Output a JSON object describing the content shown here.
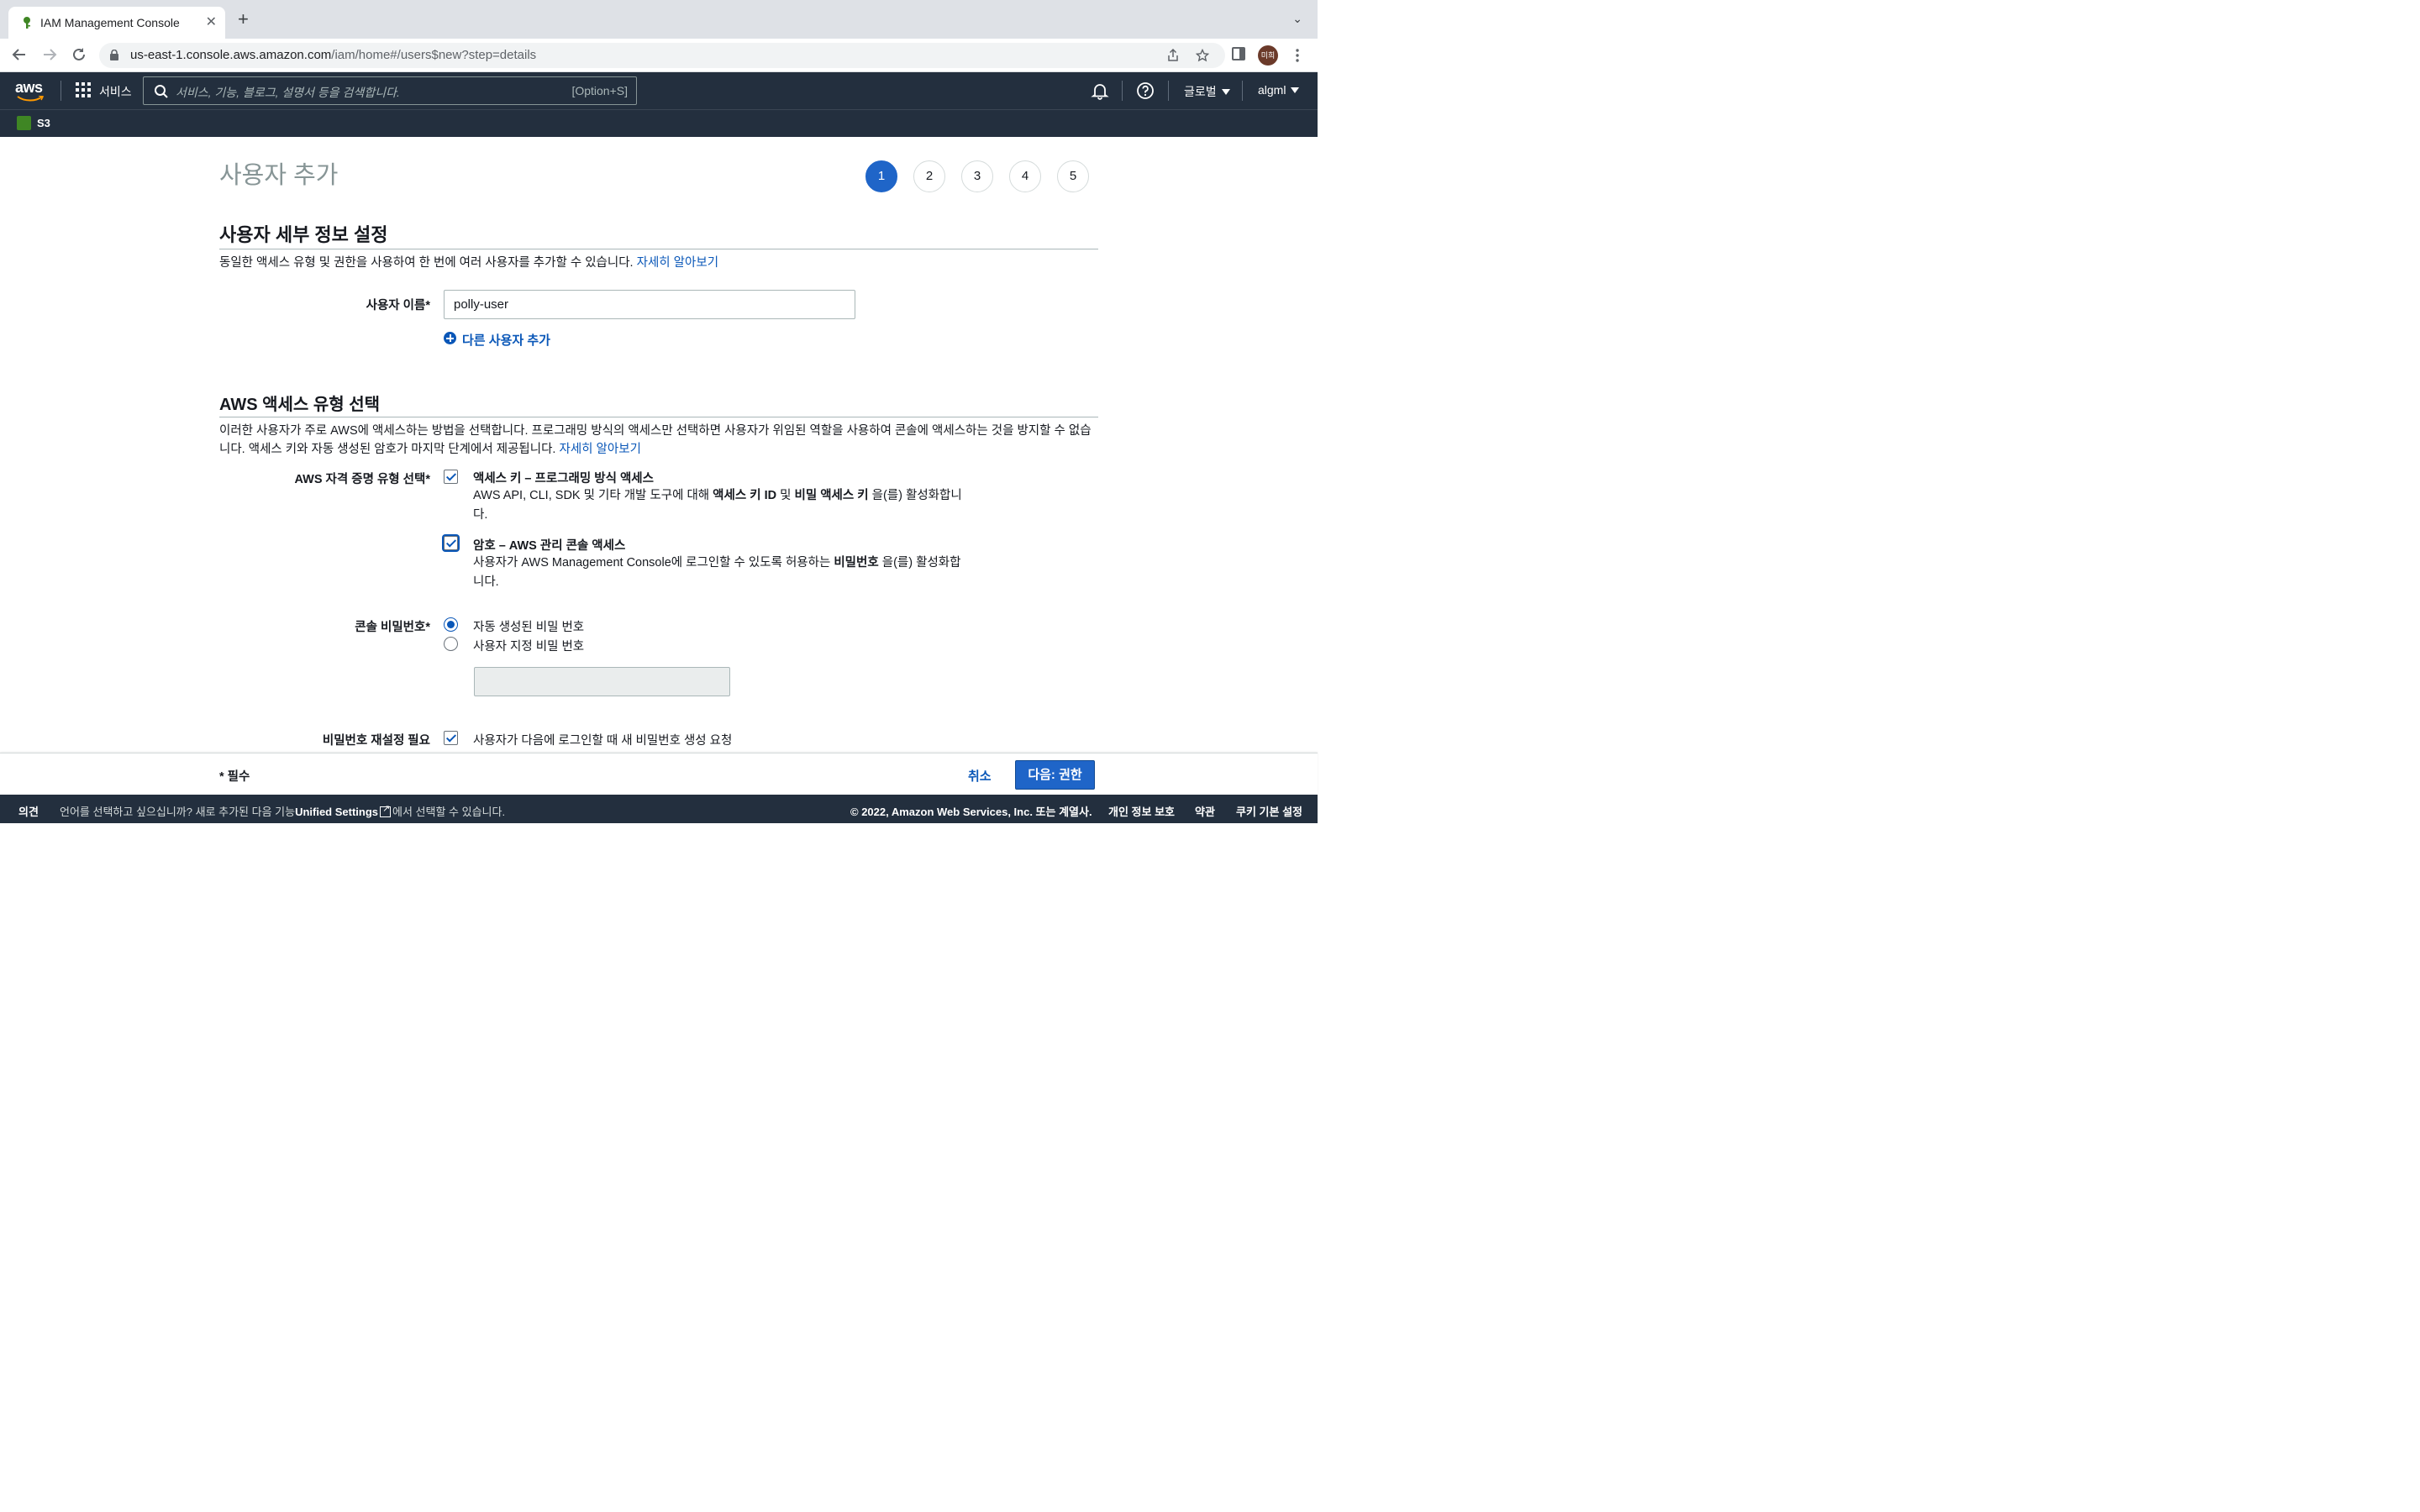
{
  "browser": {
    "tab_title": "IAM Management Console",
    "close_glyph": "✕",
    "newtab_glyph": "+",
    "tabsearch_glyph": "⌄",
    "url_host": "us-east-1.console.aws.amazon.com",
    "url_path": "/iam/home#/users$new?step=details",
    "profile_initials": "미희",
    "icons": [
      "back-arrow-icon",
      "forward-arrow-icon",
      "reload-icon",
      "lock-icon",
      "share-icon",
      "star-icon",
      "side-panel-icon",
      "more-menu-icon"
    ]
  },
  "aws_nav": {
    "logo_text": "aws",
    "services_label": "서비스",
    "search_placeholder": "서비스, 기능, 블로그, 설명서 등을 검색합니다.",
    "search_shortcut": "[Option+S]",
    "region": "글로벌",
    "account": "algml",
    "favorites": [
      {
        "label": "S3"
      }
    ]
  },
  "page": {
    "title": "사용자 추가",
    "steps": [
      "1",
      "2",
      "3",
      "4",
      "5"
    ],
    "active_step": 1,
    "accent_color": "#1f65c8",
    "details": {
      "heading": "사용자 세부 정보 설정",
      "description": "동일한 액세스 유형 및 권한을 사용하여 한 번에 여러 사용자를 추가할 수 있습니다.",
      "learn_more": "자세히 알아보기",
      "username_label": "사용자 이름*",
      "username_value": "polly-user",
      "add_another_user": "다른 사용자 추가"
    },
    "access": {
      "heading": "AWS 액세스 유형 선택",
      "description": "이러한 사용자가 주로 AWS에 액세스하는 방법을 선택합니다. 프로그래밍 방식의 액세스만 선택하면 사용자가 위임된 역할을 사용하여 콘솔에 액세스하는 것을 방지할 수 없습니다. 액세스 키와 자동 생성된 암호가 마지막 단계에서 제공됩니다.",
      "learn_more": "자세히 알아보기",
      "credential_label": "AWS 자격 증명 유형 선택*",
      "options": [
        {
          "title": "액세스 키 – 프로그래밍 방식 액세스",
          "desc_pre": "AWS API, CLI, SDK 및 기타 개발 도구에 대해 ",
          "desc_b1": "액세스 키 ID",
          "desc_mid": " 및 ",
          "desc_b2": "비밀 액세스 키",
          "desc_post": " 을(를) 활성화합니다.",
          "checked": true
        },
        {
          "title": "암호 – AWS 관리 콘솔 액세스",
          "desc_pre": "사용자가 AWS Management Console에 로그인할 수 있도록 허용하는 ",
          "desc_b1": "비밀번호",
          "desc_post": " 을(를) 활성화합니다.",
          "checked": true
        }
      ],
      "console_password_label": "콘솔 비밀번호*",
      "password_options": [
        {
          "label": "자동 생성된 비밀 번호",
          "selected": true
        },
        {
          "label": "사용자 지정 비밀 번호",
          "selected": false
        }
      ],
      "reset_label": "비밀번호 재설정 필요",
      "reset_option": "사용자가 다음에 로그인할 때 새 비밀번호 생성 요청",
      "reset_checked": true
    }
  },
  "action_bar": {
    "required_note": "* 필수",
    "cancel": "취소",
    "next": "다음: 권한"
  },
  "console_footer": {
    "feedback": "의견",
    "lang_pre": "언어를 선택하고 싶으십니까? 새로 추가된 다음 기능",
    "lang_link": "Unified Settings",
    "lang_post": "에서 선택할 수 있습니다.",
    "copyright": "© 2022, Amazon Web Services, Inc. 또는 계열사.",
    "privacy": "개인 정보 보호",
    "terms": "약관",
    "cookies": "쿠키 기본 설정"
  }
}
